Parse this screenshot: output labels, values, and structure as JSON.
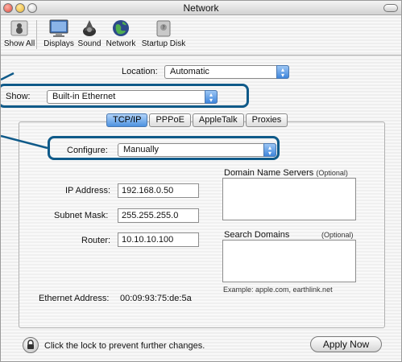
{
  "window": {
    "title": "Network"
  },
  "toolbar": {
    "items": [
      {
        "label": "Show All",
        "icon": "show-all-icon"
      },
      {
        "label": "Displays",
        "icon": "displays-icon"
      },
      {
        "label": "Sound",
        "icon": "sound-icon"
      },
      {
        "label": "Network",
        "icon": "network-icon"
      },
      {
        "label": "Startup Disk",
        "icon": "startup-disk-icon"
      }
    ]
  },
  "location": {
    "label": "Location:",
    "value": "Automatic"
  },
  "show": {
    "label": "Show:",
    "value": "Built-in Ethernet"
  },
  "tabs": [
    "TCP/IP",
    "PPPoE",
    "AppleTalk",
    "Proxies"
  ],
  "active_tab": "TCP/IP",
  "configure": {
    "label": "Configure:",
    "value": "Manually"
  },
  "ip": {
    "label": "IP Address:",
    "value": "192.168.0.50"
  },
  "subnet": {
    "label": "Subnet Mask:",
    "value": "255.255.255.0"
  },
  "router": {
    "label": "Router:",
    "value": "10.10.10.100"
  },
  "dns": {
    "label": "Domain Name Servers",
    "optional": "(Optional)"
  },
  "search": {
    "label": "Search Domains",
    "optional": "(Optional)",
    "example": "Example: apple.com, earthlink.net"
  },
  "ethernet": {
    "label": "Ethernet Address:",
    "value": "00:09:93:75:de:5a"
  },
  "footer": {
    "lock_text": "Click the lock to prevent further changes.",
    "apply_label": "Apply Now"
  },
  "colors": {
    "callout": "#0f5a89",
    "accent": "#3f86dc"
  }
}
